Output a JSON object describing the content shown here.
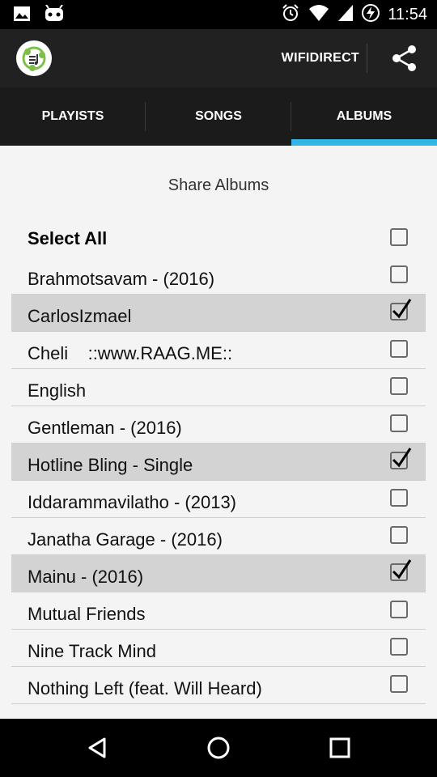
{
  "status_bar": {
    "time": "11:54",
    "icons": [
      "image-icon",
      "android-icon",
      "alarm-icon",
      "wifi-icon",
      "signal-icon",
      "battery-charging-icon"
    ]
  },
  "action_bar": {
    "logo_icon": "music-share-icon",
    "wifidirect_label": "WIFIDIRECT",
    "share_icon": "share-icon"
  },
  "tabs": [
    {
      "label": "PLAYISTS",
      "active": false
    },
    {
      "label": "SONGS",
      "active": false
    },
    {
      "label": "ALBUMS",
      "active": true
    }
  ],
  "content": {
    "title": "Share Albums",
    "select_all_label": "Select All",
    "albums": [
      {
        "label": "Brahmotsavam - (2016)",
        "checked": false
      },
      {
        "label": "CarlosIzmael",
        "checked": true
      },
      {
        "label": "Cheli    ::www.RAAG.ME::",
        "checked": false
      },
      {
        "label": "English",
        "checked": false
      },
      {
        "label": "Gentleman - (2016)",
        "checked": false
      },
      {
        "label": "Hotline Bling - Single",
        "checked": true
      },
      {
        "label": "Iddarammavilatho - (2013)",
        "checked": false
      },
      {
        "label": "Janatha Garage - (2016)",
        "checked": false
      },
      {
        "label": "Mainu - (2016)",
        "checked": true
      },
      {
        "label": "Mutual Friends",
        "checked": false
      },
      {
        "label": "Nine Track Mind",
        "checked": false
      },
      {
        "label": "Nothing Left (feat. Will Heard)",
        "checked": false
      }
    ]
  },
  "nav_bar": {
    "icons": [
      "back-icon",
      "home-icon",
      "recents-icon"
    ]
  },
  "colors": {
    "accent": "#33b5e5",
    "action_bar": "#212121",
    "tab_bar": "#1b1b1b",
    "checked_row": "#d3d3d3"
  }
}
